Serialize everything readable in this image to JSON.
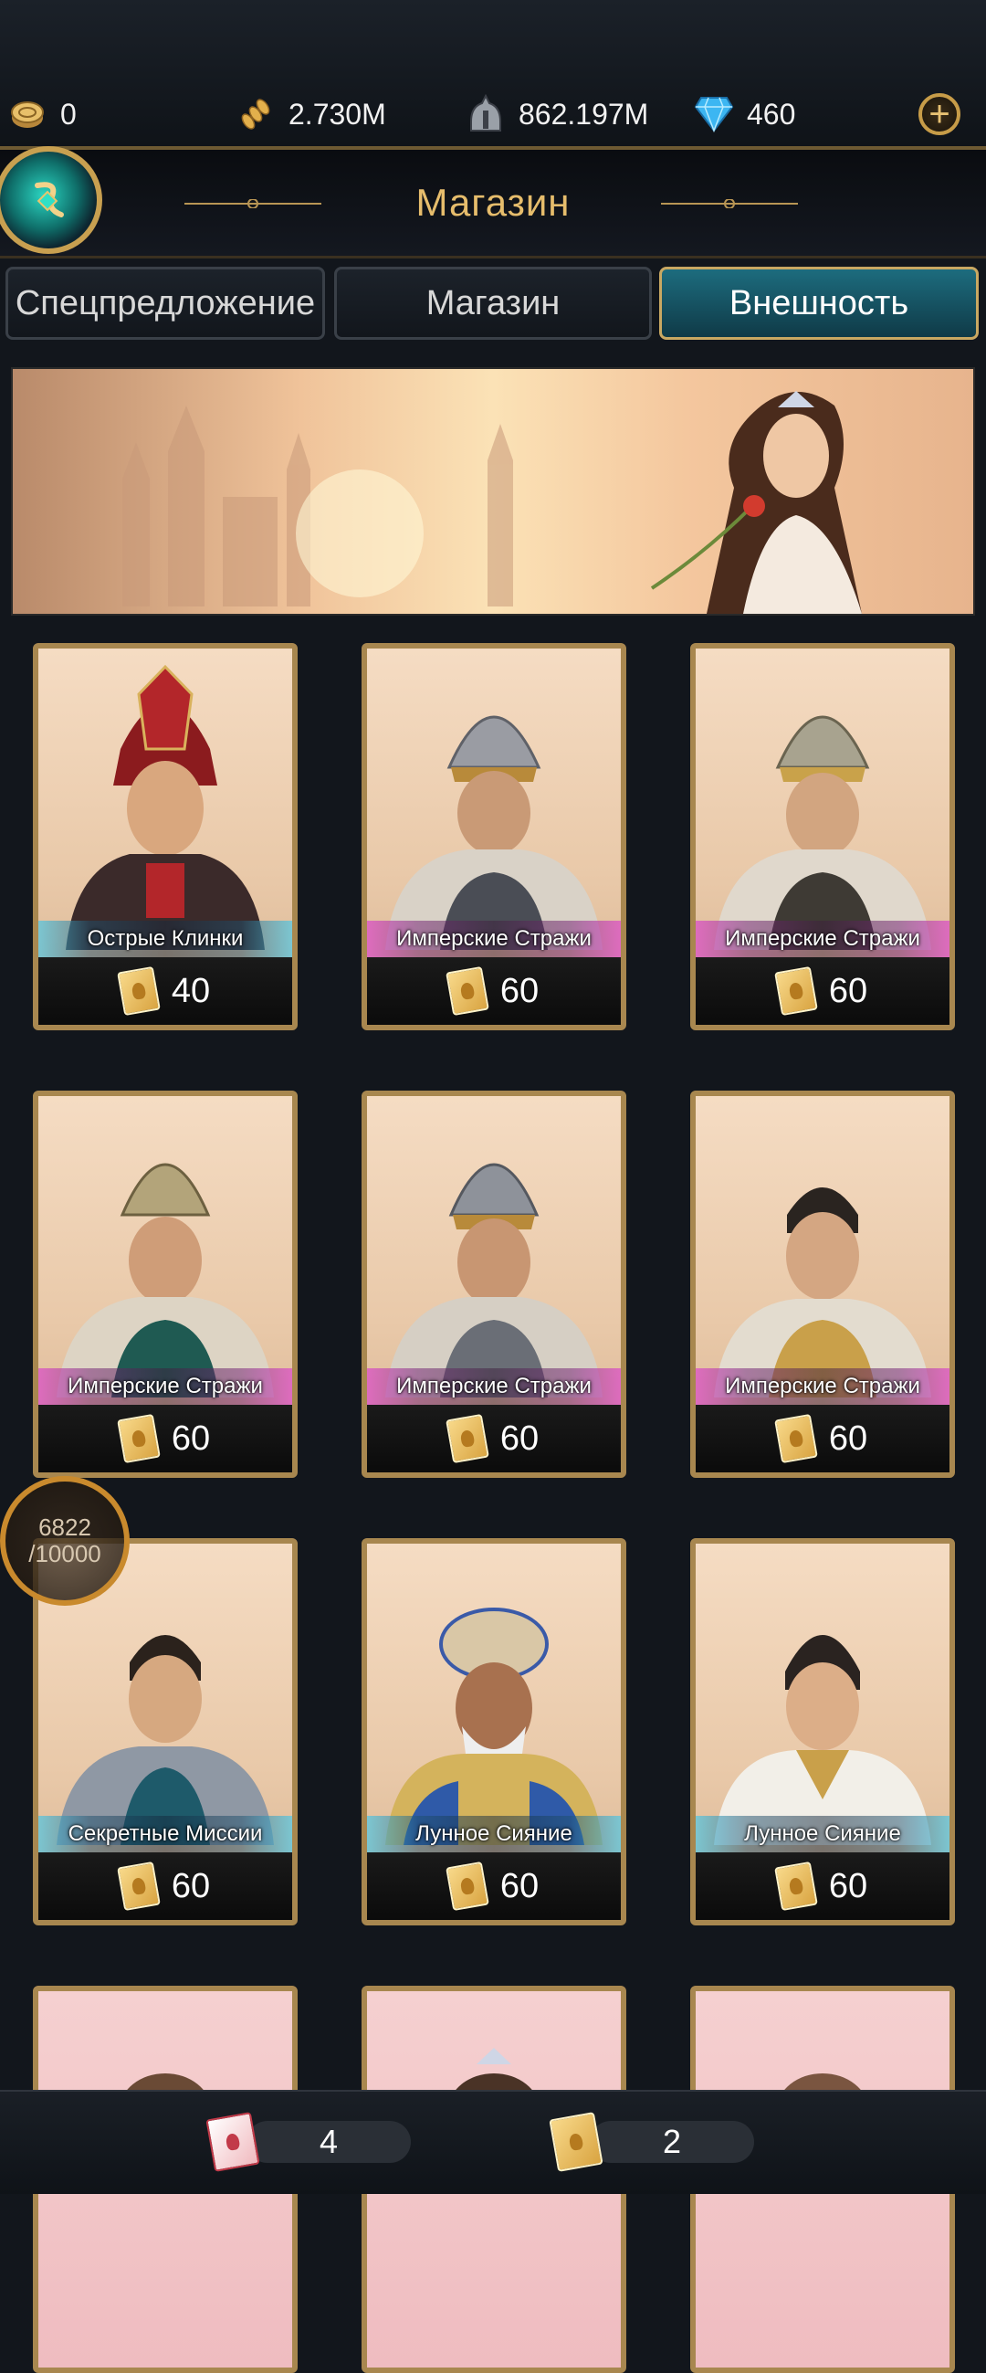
{
  "resources": {
    "coins": "0",
    "grain": "2.730M",
    "troops": "862.197M",
    "gems": "460"
  },
  "header": {
    "title": "Магазин"
  },
  "tabs": [
    {
      "label": "Спецпредложение",
      "active": false
    },
    {
      "label": "Магазин",
      "active": false
    },
    {
      "label": "Внешность",
      "active": true
    }
  ],
  "cards": [
    {
      "name": "Острые Клинки",
      "price": "40",
      "plate": "blue"
    },
    {
      "name": "Имперские Стражи",
      "price": "60",
      "plate": "pink"
    },
    {
      "name": "Имперские Стражи",
      "price": "60",
      "plate": "pink"
    },
    {
      "name": "Имперские Стражи",
      "price": "60",
      "plate": "pink"
    },
    {
      "name": "Имперские Стражи",
      "price": "60",
      "plate": "pink"
    },
    {
      "name": "Имперские Стражи",
      "price": "60",
      "plate": "pink"
    },
    {
      "name": "Секретные Миссии",
      "price": "60",
      "plate": "blue"
    },
    {
      "name": "Лунное Сияние",
      "price": "60",
      "plate": "blue"
    },
    {
      "name": "Лунное Сияние",
      "price": "60",
      "plate": "blue"
    }
  ],
  "progress": {
    "current": "6822",
    "total": "/10000"
  },
  "bottom": {
    "red_tickets": "4",
    "gold_tickets": "2"
  },
  "colors": {
    "accent": "#e6bd6c",
    "active_tab": "#1d6c7e",
    "frame": "#a8874f"
  }
}
